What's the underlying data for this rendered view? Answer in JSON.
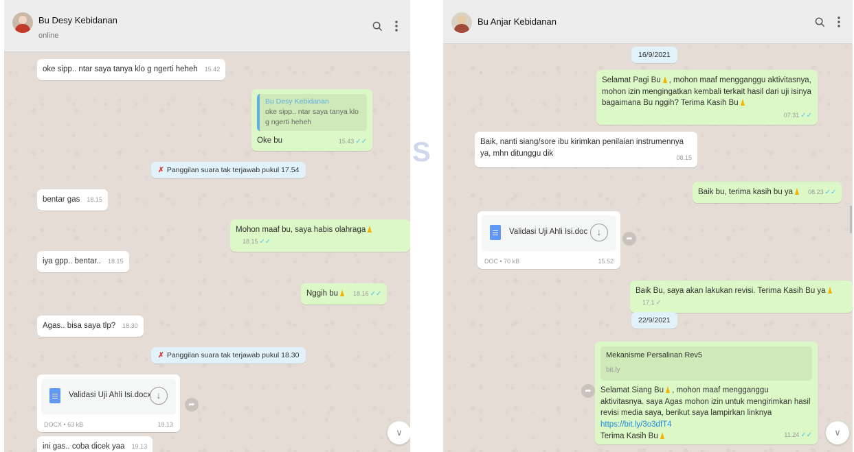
{
  "left": {
    "contact_name": "Bu Desy Kebidanan",
    "contact_status": "online",
    "messages": {
      "m1": {
        "text": "oke sipp.. ntar saya tanya klo g ngerti heheh",
        "time": "15.42"
      },
      "m2": {
        "quote_name": "Bu Desy Kebidanan",
        "quote_text": "oke sipp.. ntar saya tanya klo g ngerti heheh",
        "text": "Oke bu",
        "time": "15.43"
      },
      "call1": "Panggilan suara tak terjawab pukul 17.54",
      "m3": {
        "text": "bentar gas",
        "time": "18.15"
      },
      "m4": {
        "text": "Mohon maaf bu, saya habis olahraga",
        "time": "18.15"
      },
      "m5": {
        "text": "iya gpp.. bentar..",
        "time": "18.15"
      },
      "m6": {
        "text": "Nggih bu",
        "time": "18.16"
      },
      "m7": {
        "text": "Agas.. bisa saya tlp?",
        "time": "18.30"
      },
      "call2": "Panggilan suara tak terjawab pukul 18.30",
      "doc": {
        "name": "Validasi Uji Ahli Isi.docx",
        "meta": "DOCX • 63 kB",
        "time": "19.13"
      },
      "m8": {
        "text": "ini gas.. coba dicek yaa",
        "time": "19.13"
      }
    }
  },
  "right": {
    "contact_name": "Bu Anjar Kebidanan",
    "messages": {
      "date1": "16/9/2021",
      "r1": {
        "text_a": "Selamat Pagi Bu",
        "text_b": ", mohon maaf mengganggu aktivitasnya, mohon izin mengingatkan kembali terkait hasil dari uji isinya bagaimana Bu nggih? Terima Kasih Bu",
        "time": "07.31"
      },
      "r2": {
        "text": "Baik, nanti siang/sore ibu kirimkan penilaian instrumennya ya, mhn ditunggu dik",
        "time": "08.15"
      },
      "r3": {
        "text": "Baik bu, terima kasih bu ya",
        "time": "08.23"
      },
      "doc": {
        "name": "Validasi Uji Ahli Isi.doc",
        "meta": "DOC • 70 kB",
        "time": "15.52"
      },
      "r4": {
        "text": "Baik Bu, saya akan lakukan revisi. Terima Kasih Bu ya",
        "time": "17.1"
      },
      "date2": "22/9/2021",
      "r5": {
        "preview_title": "Mekanisme Persalinan Rev5",
        "preview_url": "bit.ly",
        "text_a": "Selamat Siang Bu",
        "text_b": ", mohon maaf mengganggu aktivitasnya. saya Agas mohon izin untuk mengirimkan hasil revisi media saya, berikut saya lampirkan linknya",
        "link": "https://bit.ly/3o3dfT4",
        "text_c": "Terima Kasih Bu",
        "time": "11.24"
      }
    }
  },
  "icons": [
    "search-icon",
    "menu-icon",
    "missed-call-icon",
    "document-icon",
    "download-icon",
    "forward-icon",
    "chevron-down-icon",
    "pray-emoji-icon",
    "double-check-icon"
  ],
  "colors": {
    "chat_bg": "#e5ddd5",
    "incoming": "#ffffff",
    "outgoing": "#dcf8c6",
    "system": "#e1f2fb",
    "tick_read": "#4fc3f7",
    "missed_call": "#e53935"
  }
}
